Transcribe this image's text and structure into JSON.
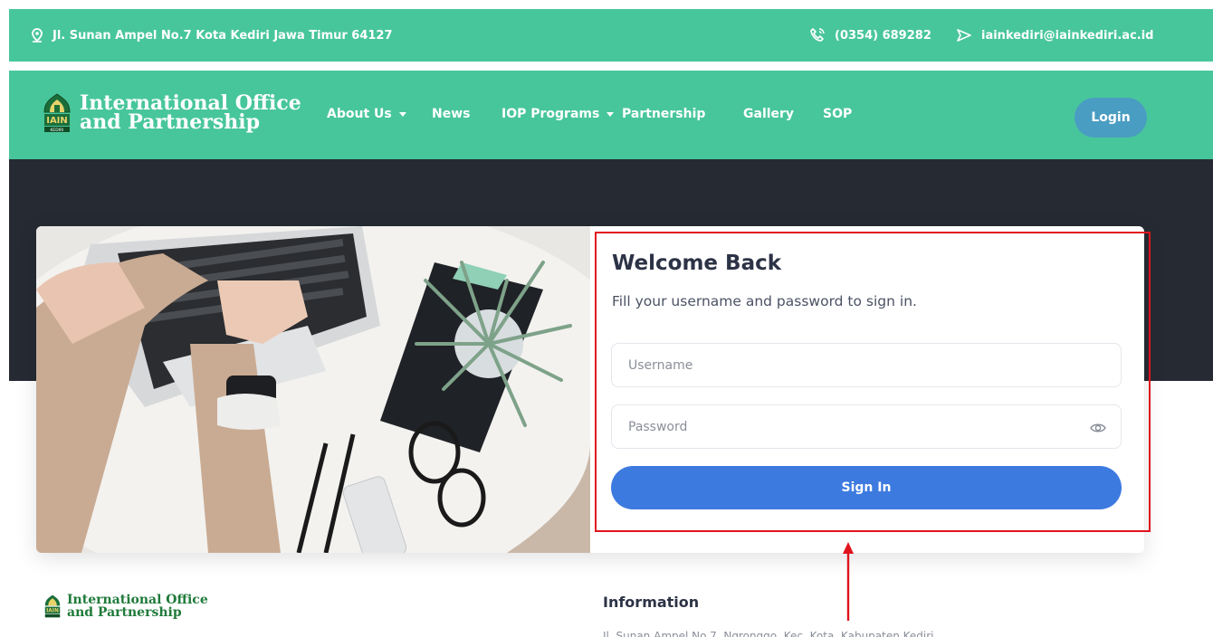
{
  "topbar": {
    "address": "Jl. Sunan Ampel No.7 Kota Kediri Jawa Timur 64127",
    "phone": "(0354) 689282",
    "email": "iainkediri@iainkediri.ac.id",
    "icons": [
      "location-pin-icon",
      "phone-icon",
      "send-icon"
    ]
  },
  "navbar": {
    "logo_line1": "International Office",
    "logo_line2": "and Partnership",
    "logo_badge": "IAIN KEDIRI",
    "links": [
      {
        "label": "About Us",
        "dropdown": true
      },
      {
        "label": "News",
        "dropdown": false
      },
      {
        "label": "IOP Programs",
        "dropdown": true
      },
      {
        "label": "Partnership",
        "dropdown": false
      },
      {
        "label": "Gallery",
        "dropdown": false
      },
      {
        "label": "SOP",
        "dropdown": false
      }
    ],
    "login_label": "Login"
  },
  "login": {
    "title": "Welcome Back",
    "subtitle": "Fill your username and password to sign in.",
    "username_placeholder": "Username",
    "password_placeholder": "Password",
    "signin_label": "Sign In"
  },
  "footer": {
    "logo_line1": "International Office",
    "logo_line2": "and Partnership",
    "info_title": "Information",
    "address_partial": "Jl. Sunan Ampel No.7, Ngronggo, Kec. Kota, Kabupaten Kediri..."
  },
  "colors": {
    "green": "#48c69b",
    "dark": "#262b33",
    "primary": "#3d7ae0",
    "login_button": "#4a9dc2",
    "highlight": "#e0141e"
  }
}
